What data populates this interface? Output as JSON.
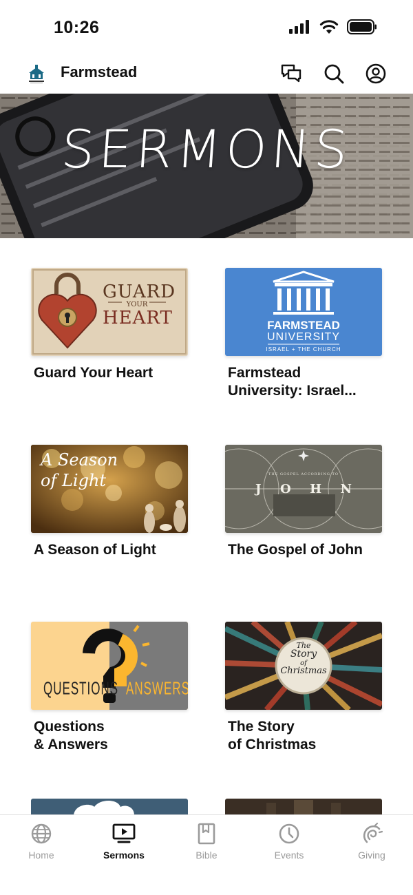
{
  "status_bar": {
    "time": "10:26",
    "icons": [
      "cellular-signal-icon",
      "wifi-icon",
      "battery-icon"
    ]
  },
  "header": {
    "logo_icon": "church-logo-icon",
    "title": "Farmstead",
    "actions": [
      "chat-icon",
      "search-icon",
      "account-icon"
    ]
  },
  "hero": {
    "title": "SERMONS"
  },
  "sermons": [
    {
      "title": "Guard Your Heart",
      "thumb": {
        "line1": "GUARD",
        "line2": "YOUR",
        "line3": "HEART"
      }
    },
    {
      "title": "Farmstead\nUniversity: Israel...",
      "thumb": {
        "line1": "FARMSTEAD",
        "line2": "UNIVERSITY",
        "line3": "ISRAEL + THE CHURCH"
      }
    },
    {
      "title": "A Season of Light",
      "thumb": {
        "line1": "A Season",
        "line2": "of Light"
      }
    },
    {
      "title": "The Gospel of John",
      "thumb": {
        "line1": "THE GOSPEL ACCORDING TO",
        "letters": [
          "J",
          "O",
          "H",
          "N"
        ]
      }
    },
    {
      "title": "Questions\n& Answers",
      "thumb": {
        "line1": "QUESTIONS",
        "line2": "ANSWERS"
      }
    },
    {
      "title": "The Story\nof Christmas",
      "thumb": {
        "line1": "The",
        "line2": "Story",
        "line3": "of",
        "line4": "Christmas"
      }
    }
  ],
  "tabs": [
    {
      "label": "Home",
      "icon": "globe-icon",
      "active": false
    },
    {
      "label": "Sermons",
      "icon": "tv-play-icon",
      "active": true
    },
    {
      "label": "Bible",
      "icon": "bookmark-book-icon",
      "active": false
    },
    {
      "label": "Events",
      "icon": "clock-icon",
      "active": false
    },
    {
      "label": "Giving",
      "icon": "giving-hand-icon",
      "active": false
    }
  ]
}
